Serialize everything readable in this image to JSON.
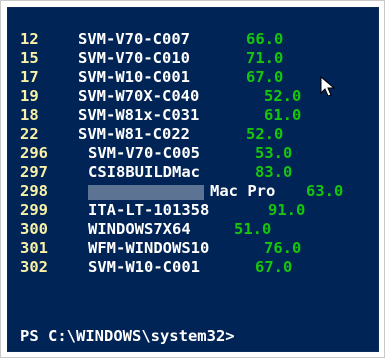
{
  "console": {
    "background": "#012456",
    "number_color": "#f9f1a5",
    "value_color": "#16c60c",
    "rows": [
      {
        "num": "12",
        "name": "SVM-V70-C007",
        "value": "66.0"
      },
      {
        "num": "15",
        "name": "SVM-V70-C010",
        "value": "71.0"
      },
      {
        "num": "17",
        "name": "SVM-W10-C001",
        "value": "67.0"
      },
      {
        "num": "19",
        "name": "SVM-W70X-C040",
        "value": "52.0"
      },
      {
        "num": "18",
        "name": "SVM-W81x-C031",
        "value": "61.0"
      },
      {
        "num": "22",
        "name": "SVM-W81-C022",
        "value": "52.0"
      },
      {
        "num": "296",
        "name": "SVM-V70-C005",
        "value": "53.0"
      },
      {
        "num": "297",
        "name": "CSI8BUILDMac",
        "value": "83.0"
      },
      {
        "num": "298",
        "name": "Mac Pro",
        "value": "63.0"
      },
      {
        "num": "299",
        "name": "ITA-LT-101358",
        "value": "91.0"
      },
      {
        "num": "300",
        "name": "WINDOWS7X64",
        "value": "51.0"
      },
      {
        "num": "301",
        "name": "WFM-WINDOWS10",
        "value": "76.0"
      },
      {
        "num": "302",
        "name": "SVM-W10-C001",
        "value": "67.0"
      }
    ],
    "prompt": "PS C:\\WINDOWS\\system32>"
  },
  "cursor": {
    "icon": "mouse-pointer-icon"
  }
}
